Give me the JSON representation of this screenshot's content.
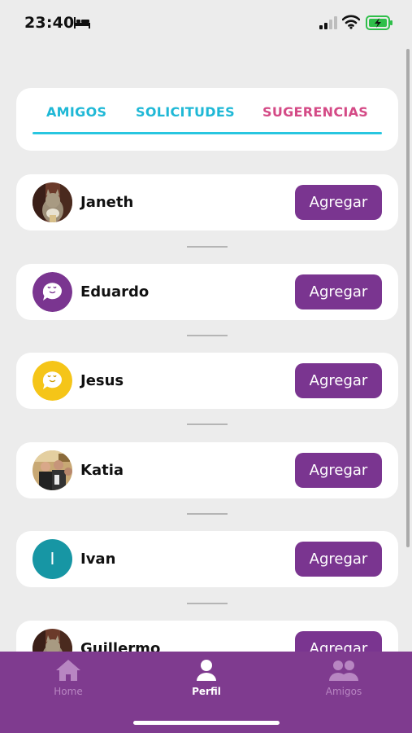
{
  "status_bar": {
    "time": "23:40"
  },
  "tabs": [
    {
      "label": "AMIGOS",
      "color": "#1fb8d6"
    },
    {
      "label": "SOLICITUDES",
      "color": "#1fb8d6"
    },
    {
      "label": "SUGERENCIAS",
      "color": "#d44a86"
    }
  ],
  "users": [
    {
      "name": "Janeth",
      "avatar": "photo-cat",
      "button": "Agregar"
    },
    {
      "name": "Eduardo",
      "avatar": "purple-chat-logo",
      "button": "Agregar"
    },
    {
      "name": "Jesus",
      "avatar": "yellow-chat-logo",
      "button": "Agregar"
    },
    {
      "name": "Katia",
      "avatar": "photo-people",
      "button": "Agregar"
    },
    {
      "name": "Ivan",
      "avatar": "teal-initial-I",
      "initial": "I",
      "button": "Agregar"
    },
    {
      "name": "Guillermo",
      "avatar": "photo-cat",
      "button": "Agregar"
    }
  ],
  "bottom_nav": {
    "home": "Home",
    "perfil": "Perfil",
    "amigos": "Amigos"
  },
  "colors": {
    "accent_purple": "#7a3590",
    "nav_bg": "#7f3b8f",
    "tab_cyan": "#1fb8d6",
    "tab_pink": "#d44a86"
  }
}
